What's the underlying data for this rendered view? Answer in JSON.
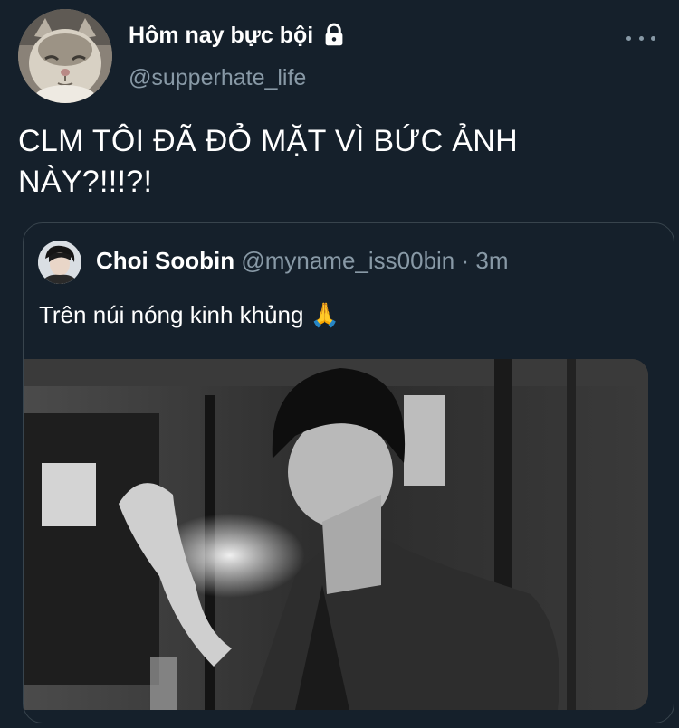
{
  "tweet": {
    "author_name": "Hôm nay bực bội",
    "author_handle": "@supperhate_life",
    "author_avatar": "cat-avatar",
    "protected_icon": "lock-icon",
    "more_icon": "more-horizontal-icon",
    "text": "CLM TÔI ĐÃ ĐỎ MẶT VÌ BỨC ẢNH NÀY?!!!?!"
  },
  "quoted": {
    "author_name": "Choi Soobin",
    "author_handle": "@myname_iss00bin",
    "separator": "·",
    "time": "3m",
    "text": "Trên núi nóng kinh khủng 🙏",
    "avatar": "person-avatar",
    "media": "black-and-white-photo"
  },
  "colors": {
    "background": "#15202b",
    "primary_text": "#ffffff",
    "secondary_text": "#8899a6",
    "border": "#38444d"
  }
}
